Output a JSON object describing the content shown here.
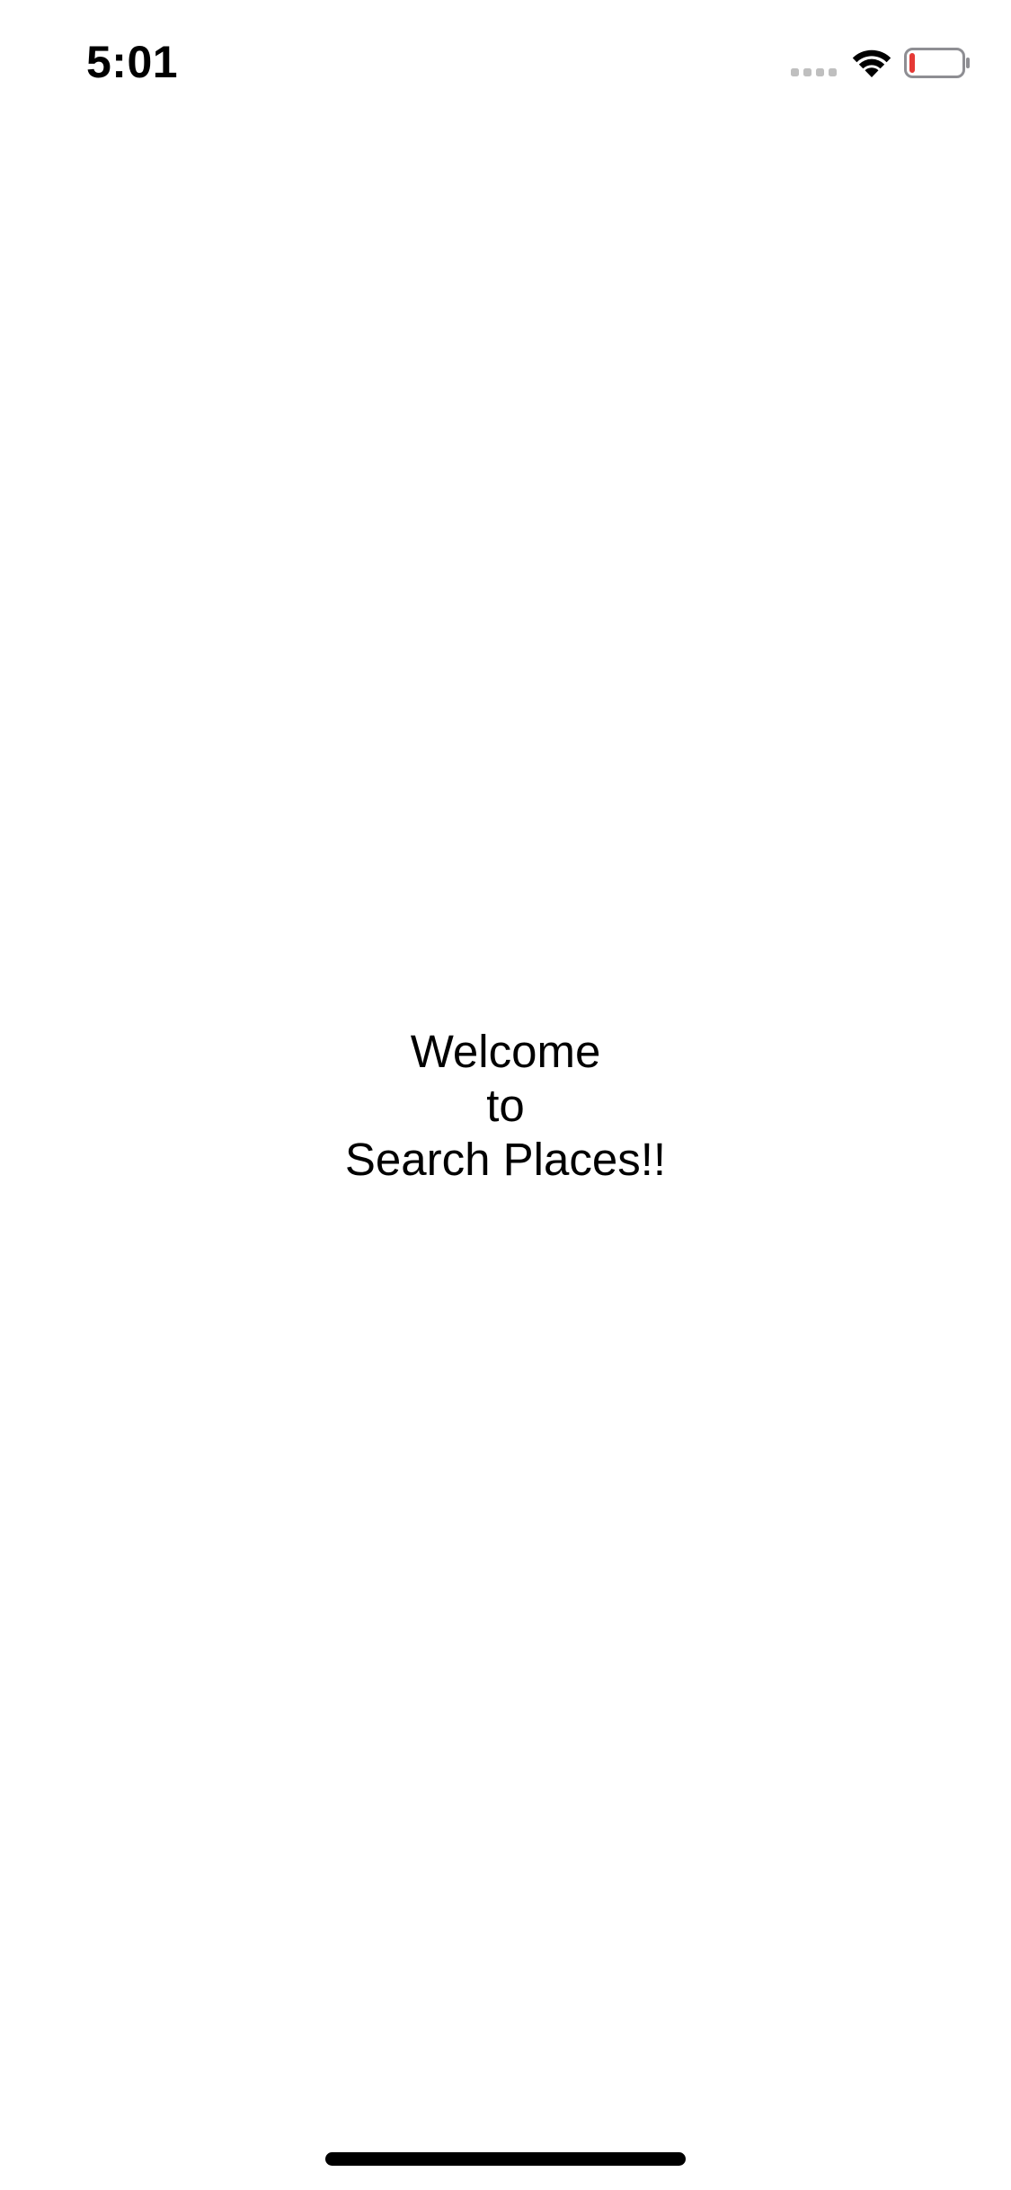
{
  "status_bar": {
    "time": "5:01",
    "signal_icon": "cellular-signal-icon",
    "wifi_icon": "wifi-icon",
    "battery_icon": "battery-low-icon",
    "battery_level": 0.1,
    "battery_color": "#e53935"
  },
  "main": {
    "welcome_lines": [
      "Welcome",
      "to",
      "Search Places!!"
    ]
  },
  "home_indicator": {
    "icon": "home-indicator"
  }
}
